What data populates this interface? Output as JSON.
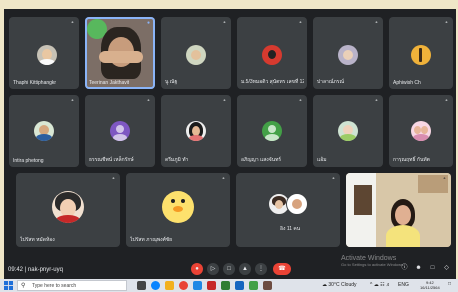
{
  "meeting": {
    "time": "09:42",
    "code": "nak-pnyr-uyq"
  },
  "participants": [
    {
      "name": "Thaphi Kittiphangkr"
    },
    {
      "name": "Teerinan Jakthavit"
    },
    {
      "name": "นู ณัฐ"
    },
    {
      "name": "ม.5/3หมอดิว สุนัตทร เลขที่ 12"
    },
    {
      "name": "ปาลาณ์ภรณ์"
    },
    {
      "name": "Aphiwish Ch"
    },
    {
      "name": "Intira phetong"
    },
    {
      "name": "ธรรณชีพน์ เหล็กรักษ์"
    },
    {
      "name": "ดรีมภูมิ ทำ"
    },
    {
      "name": "อภิญญา แสงจันทร์"
    },
    {
      "name": "แอ้ม"
    },
    {
      "name": "การุณฤทธิ์ กันทัต"
    },
    {
      "name": "ไปรัสท หมัดห้อง"
    },
    {
      "name": "ไปรัสท ภาณุพงศ์ชัย"
    },
    {
      "name": "อิง 11 คน"
    }
  ],
  "watermark": {
    "line1": "Activate Windows",
    "line2": "Go to Settings to activate Windows."
  },
  "taskbar": {
    "search_placeholder": "Type here to search",
    "weather": "30°C Cloudy",
    "lang": "ENG",
    "clock_time": "9:42",
    "clock_date": "16/11/2564"
  },
  "icons": {
    "mic": "microphone-icon",
    "mic_off": "mic-off-icon",
    "camera": "camera-icon",
    "captions": "captions-icon",
    "raise_hand": "raise-hand-icon",
    "present": "present-icon",
    "more": "more-options-icon",
    "end_call": "end-call-icon"
  },
  "colors": {
    "meet_bg": "#1f2124",
    "tile_bg": "#3c4043",
    "end_call_red": "#ea4335",
    "active_speaker": "#8ab4f8"
  }
}
